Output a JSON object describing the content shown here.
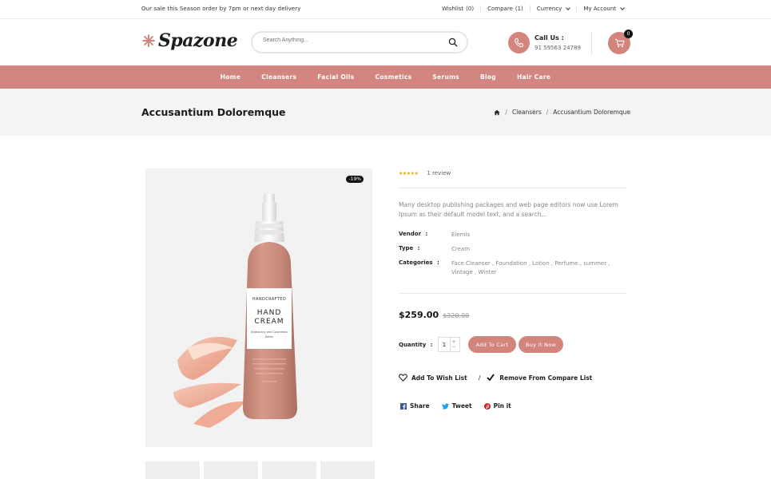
{
  "topbar": {
    "promo": "Our sale this Season order by 7pm or next day delivery",
    "wishlist": "Wishlist",
    "wishlist_count": "(0)",
    "compare": "Compare",
    "compare_count": "(1)",
    "currency": "Currency",
    "account": "My Account"
  },
  "header": {
    "logo": "Spazone",
    "search_placeholder": "Search Anything...",
    "call_title": "Call Us :",
    "call_number": "91 59563 24789",
    "cart_count": "0"
  },
  "nav": {
    "items": [
      "Home",
      "Cleansers",
      "Facial Oils",
      "Cosmetics",
      "Serums",
      "Blog",
      "Hair Care"
    ]
  },
  "breadcrumb": {
    "title": "Accusantium Doloremque",
    "crumbs": [
      "Cleansers",
      "Accusantium Doloremque"
    ]
  },
  "product": {
    "discount_badge": "-19%",
    "label_brand": "HANDCRAFTED",
    "label_line1": "HAND",
    "label_line2": "CREAM",
    "label_sub1": "Stationary and Cosmetics",
    "label_sub2": "Items",
    "rating": 5,
    "stars": "★★★★★",
    "reviews": "1 review",
    "description": "Many desktop publishing packages and web page editors now use Lorem Ipsum as their default model text, and a search...",
    "vendor_label": "Vendor",
    "vendor": "Elemis",
    "type_label": "Type",
    "type": "Cream",
    "categories_label": "Categories",
    "categories": "Face Cleanser , Foundation , Lotion , Perfume , summer , Vintage , Winter",
    "price": "$259.00",
    "old_price": "$320.00",
    "quantity_label": "Quantity",
    "quantity": "1",
    "add_to_cart": "Add To Cart",
    "buy_now": "Buy It Now",
    "wishlist": "Add To Wish List",
    "compare": "Remove From Compare List",
    "share": "Share",
    "tweet": "Tweet",
    "pin": "Pin it"
  },
  "colors": {
    "accent": "#d2867f",
    "band": "#f4f4f4",
    "stars": "#f2a60c"
  }
}
